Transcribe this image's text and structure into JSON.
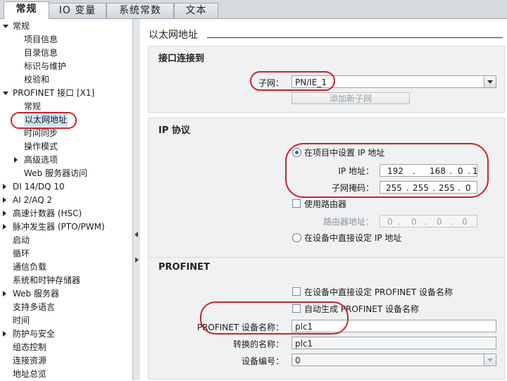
{
  "tabs": [
    {
      "label": "常规",
      "active": true
    },
    {
      "label": "IO 变量",
      "active": false
    },
    {
      "label": "系统常数",
      "active": false
    },
    {
      "label": "文本",
      "active": false
    }
  ],
  "tree": [
    {
      "label": "常规",
      "level": 0,
      "arrow": "down"
    },
    {
      "label": "项目信息",
      "level": 1
    },
    {
      "label": "目录信息",
      "level": 1
    },
    {
      "label": "标识与维护",
      "level": 1
    },
    {
      "label": "校验和",
      "level": 1
    },
    {
      "label": "PROFINET 接口 [X1]",
      "level": 0,
      "arrow": "down"
    },
    {
      "label": "常规",
      "level": 1
    },
    {
      "label": "以太网地址",
      "level": 1,
      "selected": true
    },
    {
      "label": "时间同步",
      "level": 1
    },
    {
      "label": "操作模式",
      "level": 1
    },
    {
      "label": "高级选项",
      "level": 1,
      "arrow": "right"
    },
    {
      "label": "Web 服务器访问",
      "level": 1
    },
    {
      "label": "DI 14/DQ 10",
      "level": 0,
      "arrow": "right"
    },
    {
      "label": "AI 2/AQ 2",
      "level": 0,
      "arrow": "right"
    },
    {
      "label": "高速计数器 (HSC)",
      "level": 0,
      "arrow": "right"
    },
    {
      "label": "脉冲发生器 (PTO/PWM)",
      "level": 0,
      "arrow": "right"
    },
    {
      "label": "启动",
      "level": 0
    },
    {
      "label": "循环",
      "level": 0
    },
    {
      "label": "通信负载",
      "level": 0
    },
    {
      "label": "系统和时钟存储器",
      "level": 0
    },
    {
      "label": "Web 服务器",
      "level": 0,
      "arrow": "right"
    },
    {
      "label": "支持多语言",
      "level": 0
    },
    {
      "label": "时间",
      "level": 0
    },
    {
      "label": "防护与安全",
      "level": 0,
      "arrow": "right"
    },
    {
      "label": "组态控制",
      "level": 0
    },
    {
      "label": "连接资源",
      "level": 0
    },
    {
      "label": "地址总览",
      "level": 0
    }
  ],
  "page_title": "以太网地址",
  "interface": {
    "title": "接口连接到",
    "subnet_label": "子网：",
    "subnet_value": "PN/IE_1",
    "add_subnet_button": "添加新子网"
  },
  "ip": {
    "title": "IP 协议",
    "set_in_project": "在项目中设置 IP 地址",
    "ip_label": "IP 地址：",
    "ip_address": [
      "192",
      "168",
      "0",
      "1"
    ],
    "mask_label": "子网掩码：",
    "subnet_mask": [
      "255",
      "255",
      "255",
      "0"
    ],
    "use_router": "使用路由器",
    "router_label": "路由器地址：",
    "router_address": [
      "0",
      "0",
      "0",
      "0"
    ],
    "set_on_device": "在设备中直接设定 IP 地址",
    "selected_option": "set_in_project"
  },
  "profinet": {
    "title": "PROFINET",
    "set_name_on_device": "在设备中直接设定 PROFINET 设备名称",
    "auto_generate": "自动生成 PROFINET 设备名称",
    "device_name_label": "PROFINET 设备名称：",
    "device_name": "plc1",
    "converted_label": "转换的名称：",
    "converted_name": "plc1",
    "device_number_label": "设备编号：",
    "device_number": "0"
  },
  "colors": {
    "highlight_ring": "#d0202a",
    "selection": "#cfe3f7",
    "radio_dot": "#1a6fd0"
  }
}
